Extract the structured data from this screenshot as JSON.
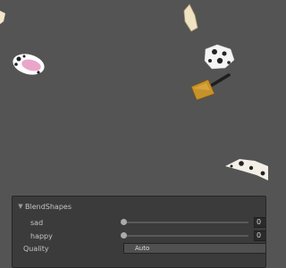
{
  "panel": {
    "section_title": "BlendShapes",
    "rows": [
      {
        "label": "sad",
        "value": "0",
        "level": 0
      },
      {
        "label": "happy",
        "value": "0",
        "level": 0
      }
    ],
    "quality": {
      "label": "Quality",
      "selected": "Auto"
    }
  },
  "icons": {
    "foldout": "▼",
    "dropdown_arrow": "▼"
  },
  "colors": {
    "viewport_bg": "#545454",
    "panel_bg": "#3b3b3b"
  }
}
